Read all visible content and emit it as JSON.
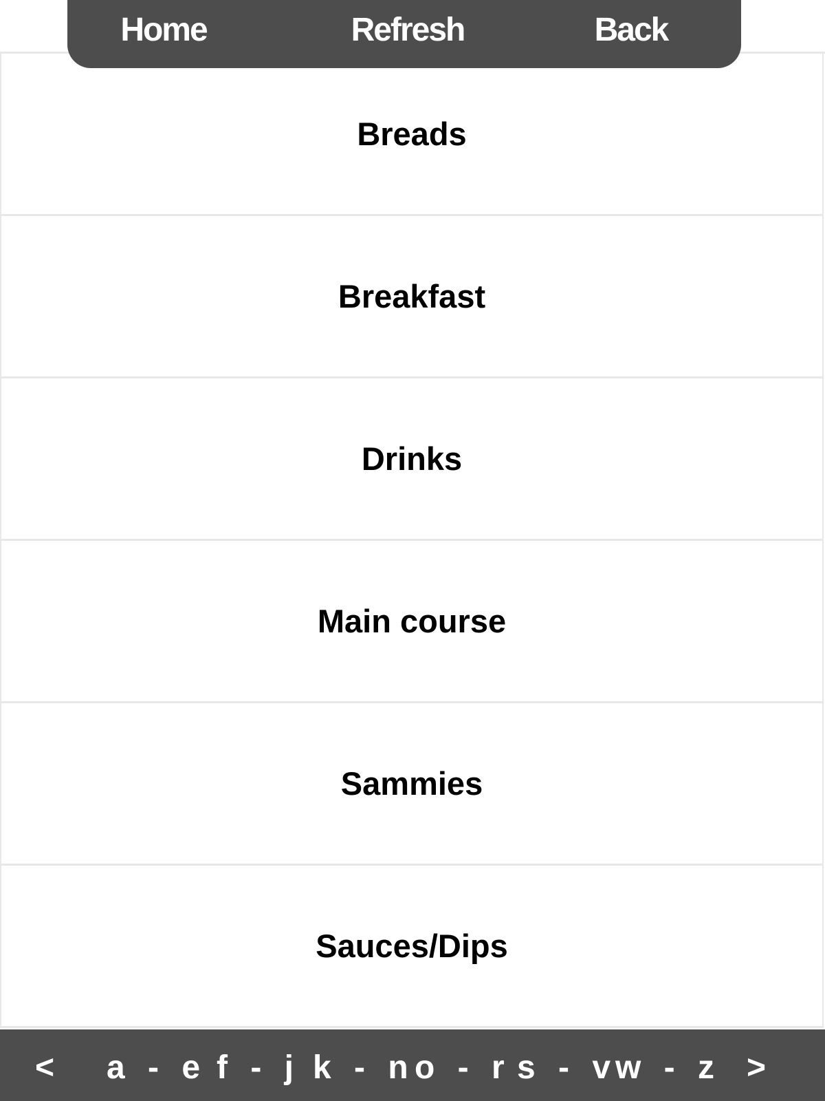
{
  "top_nav": {
    "home_label": "Home",
    "refresh_label": "Refresh",
    "back_label": "Back"
  },
  "categories": [
    {
      "label": "Breads"
    },
    {
      "label": "Breakfast"
    },
    {
      "label": "Drinks"
    },
    {
      "label": "Main course"
    },
    {
      "label": "Sammies"
    },
    {
      "label": "Sauces/Dips"
    }
  ],
  "alpha_index": {
    "prev_label": "<",
    "ranges": [
      "a - e",
      "f - j",
      "k - n",
      "o - r",
      "s - v",
      "w - z"
    ],
    "next_label": ">"
  },
  "colors": {
    "bar_background": "#4d4d4d",
    "divider": "#e8e8e8",
    "text": "#000000",
    "bar_text": "#ffffff"
  }
}
